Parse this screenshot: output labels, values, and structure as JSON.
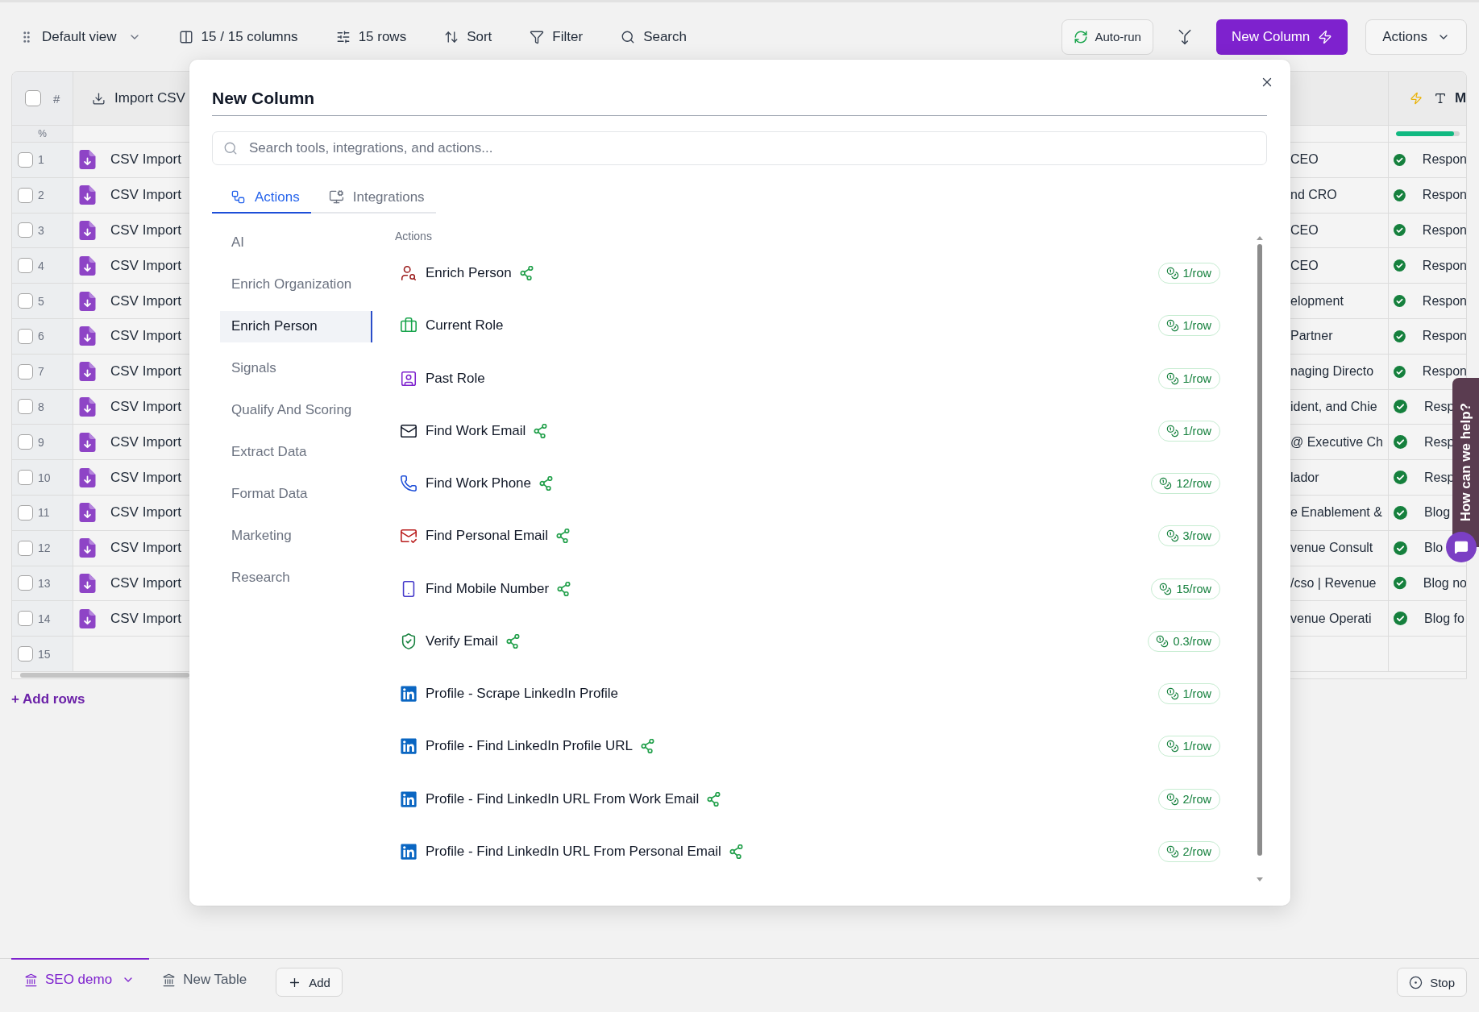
{
  "toolbar": {
    "view": {
      "label": "Default view"
    },
    "items": [
      {
        "kind": "columns",
        "label": "15 / 15 columns"
      },
      {
        "kind": "rows",
        "label": "15 rows"
      },
      {
        "kind": "sort",
        "label": "Sort"
      },
      {
        "kind": "filter",
        "label": "Filter"
      },
      {
        "kind": "search",
        "label": "Search"
      }
    ],
    "auto_run": "Auto-run",
    "new_column": "New Column",
    "actions": "Actions"
  },
  "table": {
    "header": {
      "select_all": {
        "checked": false
      },
      "number": "#",
      "source": "Import CSV",
      "column_4": "M",
      "progress_label": "%",
      "column_4_progress": {
        "level": 0.91
      }
    },
    "rows": [
      {
        "number": "1",
        "checked": false,
        "source": "CSV Import",
        "column_3": "CEO",
        "column_4": {
          "done": true,
          "text": "Respon"
        }
      },
      {
        "number": "2",
        "checked": false,
        "source": "CSV Import",
        "column_3": "nd CRO",
        "column_4": {
          "done": true,
          "text": "Respon"
        }
      },
      {
        "number": "3",
        "checked": false,
        "source": "CSV Import",
        "column_3": "CEO",
        "column_4": {
          "done": true,
          "text": "Respon"
        }
      },
      {
        "number": "4",
        "checked": false,
        "source": "CSV Import",
        "column_3": "CEO",
        "column_4": {
          "done": true,
          "text": "Respon"
        }
      },
      {
        "number": "5",
        "checked": false,
        "source": "CSV Import",
        "column_3": "elopment",
        "column_4": {
          "done": true,
          "text": "Respon"
        }
      },
      {
        "number": "6",
        "checked": false,
        "source": "CSV Import",
        "column_3": "Partner",
        "column_4": {
          "done": true,
          "text": "Respon"
        }
      },
      {
        "number": "7",
        "checked": false,
        "source": "CSV Import",
        "column_3": "naging Directo",
        "column_4": {
          "done": true,
          "text": "Respon"
        }
      },
      {
        "number": "8",
        "checked": false,
        "source": "CSV Import",
        "column_3": "ident, and Chie",
        "column_4": {
          "done": true,
          "text": "Resp"
        }
      },
      {
        "number": "9",
        "checked": false,
        "source": "CSV Import",
        "column_3": "@ Executive Ch",
        "column_4": {
          "done": true,
          "text": "Resp"
        }
      },
      {
        "number": "10",
        "checked": false,
        "source": "CSV Import",
        "column_3": "lador",
        "column_4": {
          "done": true,
          "text": "Resp"
        }
      },
      {
        "number": "11",
        "checked": false,
        "source": "CSV Import",
        "column_3": "e Enablement &",
        "column_4": {
          "done": true,
          "text": "Blog"
        }
      },
      {
        "number": "12",
        "checked": false,
        "source": "CSV Import",
        "column_3": "venue Consult",
        "column_4": {
          "done": true,
          "text": "Blo"
        }
      },
      {
        "number": "13",
        "checked": false,
        "source": "CSV Import",
        "column_3": "/cso | Revenue",
        "column_4": {
          "done": true,
          "text": "Blog no"
        }
      },
      {
        "number": "14",
        "checked": false,
        "source": "CSV Import",
        "column_3": "venue Operati",
        "column_4": {
          "done": true,
          "text": "Blog fo"
        }
      },
      {
        "number": "15",
        "checked": false
      }
    ]
  },
  "add_rows": "+ Add rows",
  "new_column_dialog": {
    "title": "New Column",
    "search": {
      "placeholder": "Search tools, integrations, and actions..."
    },
    "tabs": [
      {
        "label": "Actions",
        "selected": true
      },
      {
        "label": "Integrations",
        "selected": false
      }
    ],
    "categories": [
      {
        "label": "AI",
        "selected": false
      },
      {
        "label": "Enrich Organization",
        "selected": false
      },
      {
        "label": "Enrich Person",
        "selected": true
      },
      {
        "label": "Signals",
        "selected": false
      },
      {
        "label": "Qualify And Scoring",
        "selected": false
      },
      {
        "label": "Extract Data",
        "selected": false
      },
      {
        "label": "Format Data",
        "selected": false
      },
      {
        "label": "Marketing",
        "selected": false
      },
      {
        "label": "Research",
        "selected": false
      }
    ],
    "section_title": "Actions",
    "actions": [
      {
        "label": "Enrich Person",
        "workflow_icon": true,
        "cost": "1/row"
      },
      {
        "label": "Current Role",
        "workflow_icon": false,
        "cost": "1/row"
      },
      {
        "label": "Past Role",
        "workflow_icon": false,
        "cost": "1/row"
      },
      {
        "label": "Find Work Email",
        "workflow_icon": true,
        "cost": "1/row"
      },
      {
        "label": "Find Work Phone",
        "workflow_icon": true,
        "cost": "12/row"
      },
      {
        "label": "Find Personal Email",
        "workflow_icon": true,
        "cost": "3/row"
      },
      {
        "label": "Find Mobile Number",
        "workflow_icon": true,
        "cost": "15/row"
      },
      {
        "label": "Verify Email",
        "workflow_icon": true,
        "cost": "0.3/row"
      },
      {
        "label": "Profile - Scrape LinkedIn Profile",
        "workflow_icon": false,
        "cost": "1/row"
      },
      {
        "label": "Profile - Find LinkedIn Profile URL",
        "workflow_icon": true,
        "cost": "1/row"
      },
      {
        "label": "Profile - Find LinkedIn URL From Work Email",
        "workflow_icon": true,
        "cost": "2/row"
      },
      {
        "label": "Profile - Find LinkedIn URL From Personal Email",
        "workflow_icon": true,
        "cost": "2/row"
      }
    ]
  },
  "help_widget": {
    "label": "How can we help?"
  },
  "bottom_bar": {
    "tables": [
      {
        "label": "SEO demo",
        "selected": true
      },
      {
        "label": "New Table",
        "selected": false
      }
    ],
    "add": "Add",
    "stop": "Stop"
  }
}
